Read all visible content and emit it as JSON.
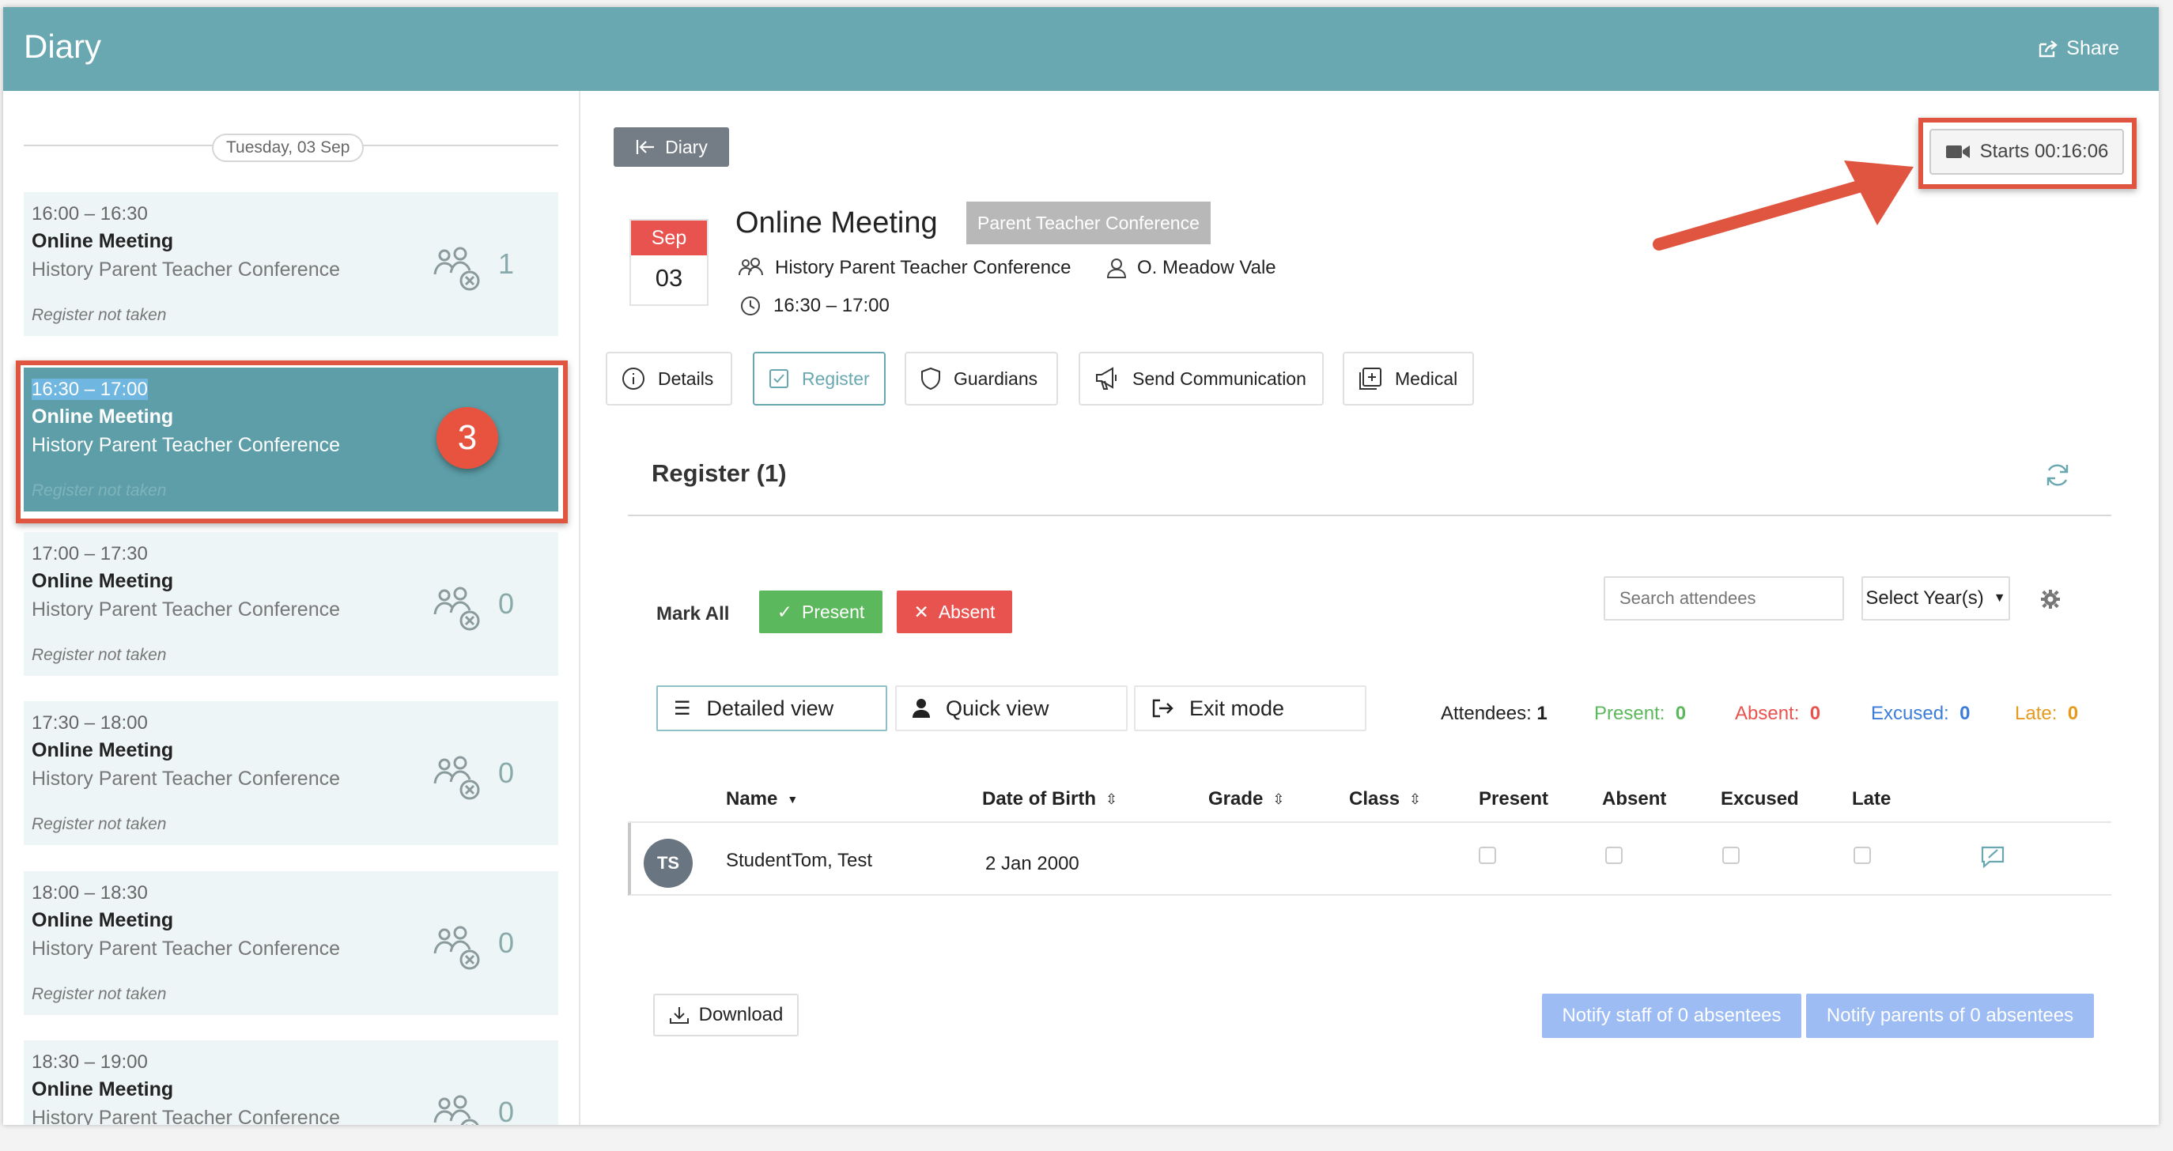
{
  "header": {
    "title": "Diary",
    "share_label": "Share"
  },
  "sidebar": {
    "date": "Tuesday, 03 Sep",
    "slots": [
      {
        "time": "16:00 – 16:30",
        "name": "Online Meeting",
        "subtitle": "History Parent Teacher Conference",
        "register": "Register not taken",
        "count": "1"
      },
      {
        "time": "16:30 – 17:00",
        "name": "Online Meeting",
        "subtitle": "History Parent Teacher Conference",
        "register": "Register not taken",
        "count": ""
      },
      {
        "time": "17:00 – 17:30",
        "name": "Online Meeting",
        "subtitle": "History Parent Teacher Conference",
        "register": "Register not taken",
        "count": "0"
      },
      {
        "time": "17:30 – 18:00",
        "name": "Online Meeting",
        "subtitle": "History Parent Teacher Conference",
        "register": "Register not taken",
        "count": "0"
      },
      {
        "time": "18:00 – 18:30",
        "name": "Online Meeting",
        "subtitle": "History Parent Teacher Conference",
        "register": "Register not taken",
        "count": "0"
      },
      {
        "time": "18:30 – 19:00",
        "name": "Online Meeting",
        "subtitle": "History Parent Teacher Conference",
        "register": "",
        "count": "0"
      }
    ],
    "step_badge": "3"
  },
  "main": {
    "back_label": "Diary",
    "starts_label": "Starts 00:16:06",
    "date_month": "Sep",
    "date_day": "03",
    "event_title": "Online Meeting",
    "event_tag": "Parent Teacher Conference",
    "group": "History Parent Teacher Conference",
    "teacher": "O. Meadow Vale",
    "time": "16:30 – 17:00",
    "tabs": [
      "Details",
      "Register",
      "Guardians",
      "Send Communication",
      "Medical"
    ],
    "register_title": "Register (1)",
    "mark_all": "Mark All",
    "present_label": "Present",
    "absent_label": "Absent",
    "search_placeholder": "Search attendees",
    "select_years": "Select Year(s)",
    "views": [
      "Detailed view",
      "Quick view",
      "Exit mode"
    ],
    "stats": {
      "attendees_label": "Attendees:",
      "attendees": "1",
      "present_label": "Present:",
      "present": "0",
      "absent_label": "Absent:",
      "absent": "0",
      "excused_label": "Excused:",
      "excused": "0",
      "late_label": "Late:",
      "late": "0"
    },
    "columns": [
      "Name",
      "Date of Birth",
      "Grade",
      "Class",
      "Present",
      "Absent",
      "Excused",
      "Late"
    ],
    "rows": [
      {
        "initials": "TS",
        "name": "StudentTom, Test",
        "dob": "2 Jan 2000"
      }
    ],
    "download_label": "Download",
    "notify_staff": "Notify staff of 0 absentees",
    "notify_parents": "Notify parents of 0 absentees"
  },
  "colors": {
    "accent": "#69a7b1",
    "present": "#5cb85c",
    "absent": "#e8534f",
    "highlight": "#e0553f"
  }
}
